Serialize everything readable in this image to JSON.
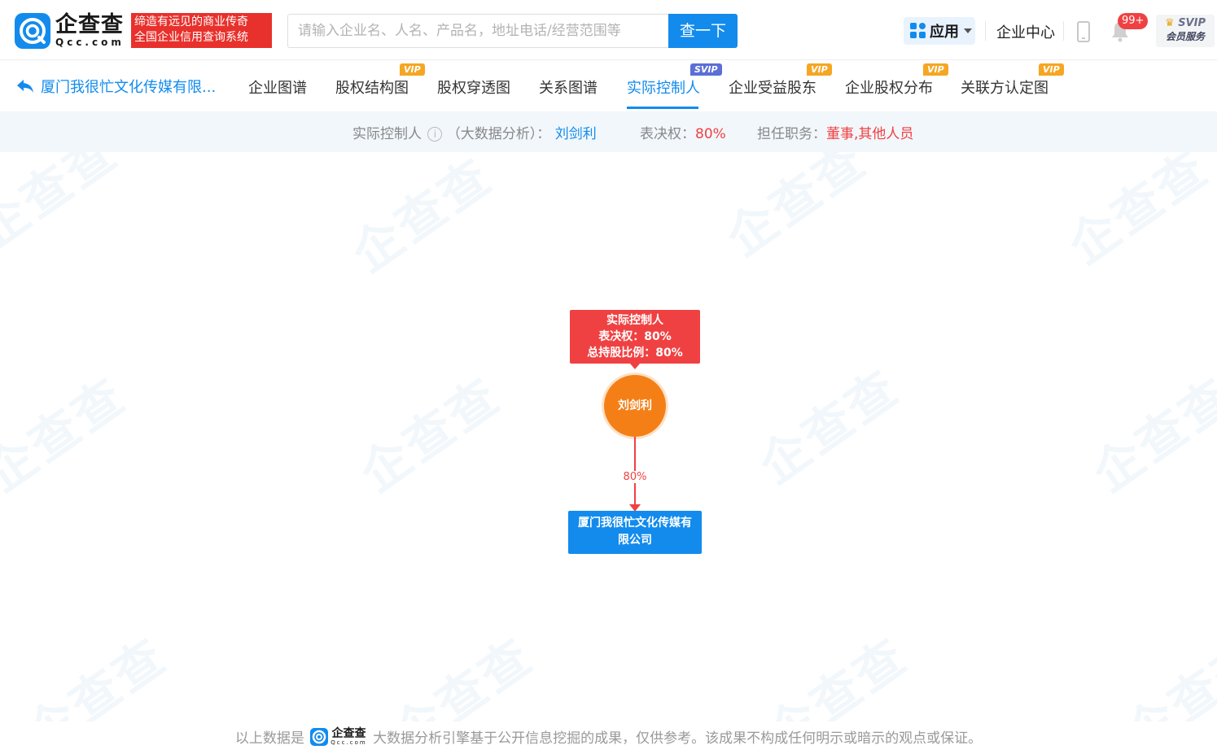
{
  "header": {
    "logo_cn": "企查查",
    "logo_en": "Qcc.com",
    "slogan_line1": "缔造有远见的商业传奇",
    "slogan_line2": "全国企业信用查询系统",
    "search_placeholder": "请输入企业名、人名、产品名，地址电话/经营范围等",
    "search_button": "查一下",
    "apps_label": "应用",
    "enterprise_center": "企业中心",
    "notification_count": "99+",
    "svip_label": "SVIP",
    "svip_sub": "会员服务"
  },
  "nav": {
    "back_label": "厦门我很忙文化传媒有限...",
    "tabs": [
      {
        "label": "企业图谱",
        "tag": ""
      },
      {
        "label": "股权结构图",
        "tag": "VIP"
      },
      {
        "label": "股权穿透图",
        "tag": ""
      },
      {
        "label": "关系图谱",
        "tag": ""
      },
      {
        "label": "实际控制人",
        "tag": "SVIP",
        "active": true
      },
      {
        "label": "企业受益股东",
        "tag": "VIP"
      },
      {
        "label": "企业股权分布",
        "tag": "VIP"
      },
      {
        "label": "关联方认定图",
        "tag": "VIP"
      }
    ]
  },
  "info": {
    "controller_label": "实际控制人",
    "analysis_label": "（大数据分析）：",
    "controller_name": "刘剑利",
    "voting_label": "表决权：",
    "voting_value": "80%",
    "position_label": "担任职务：",
    "position_value": "董事,其他人员"
  },
  "chart": {
    "box_title": "实际控制人",
    "box_voting": "表决权：80%",
    "box_holding": "总持股比例：80%",
    "person_name": "刘剑利",
    "edge_percent": "80%",
    "company_name": "厦门我很忙文化传媒有限公司"
  },
  "watermark": {
    "text_cn": "企查查",
    "text_en": "Qcc.com"
  },
  "footer": {
    "prefix": "以上数据是",
    "logo_cn": "企查查",
    "logo_en": "Qcc.com",
    "suffix": "大数据分析引擎基于公开信息挖掘的成果，仅供参考。该成果不构成任何明示或暗示的观点或保证。"
  },
  "colors": {
    "brand_blue": "#128bed",
    "alert_red": "#f04142",
    "person_orange": "#f57f17",
    "vip_gold": "#f5a623",
    "svip_purple": "#5b6fd6"
  }
}
